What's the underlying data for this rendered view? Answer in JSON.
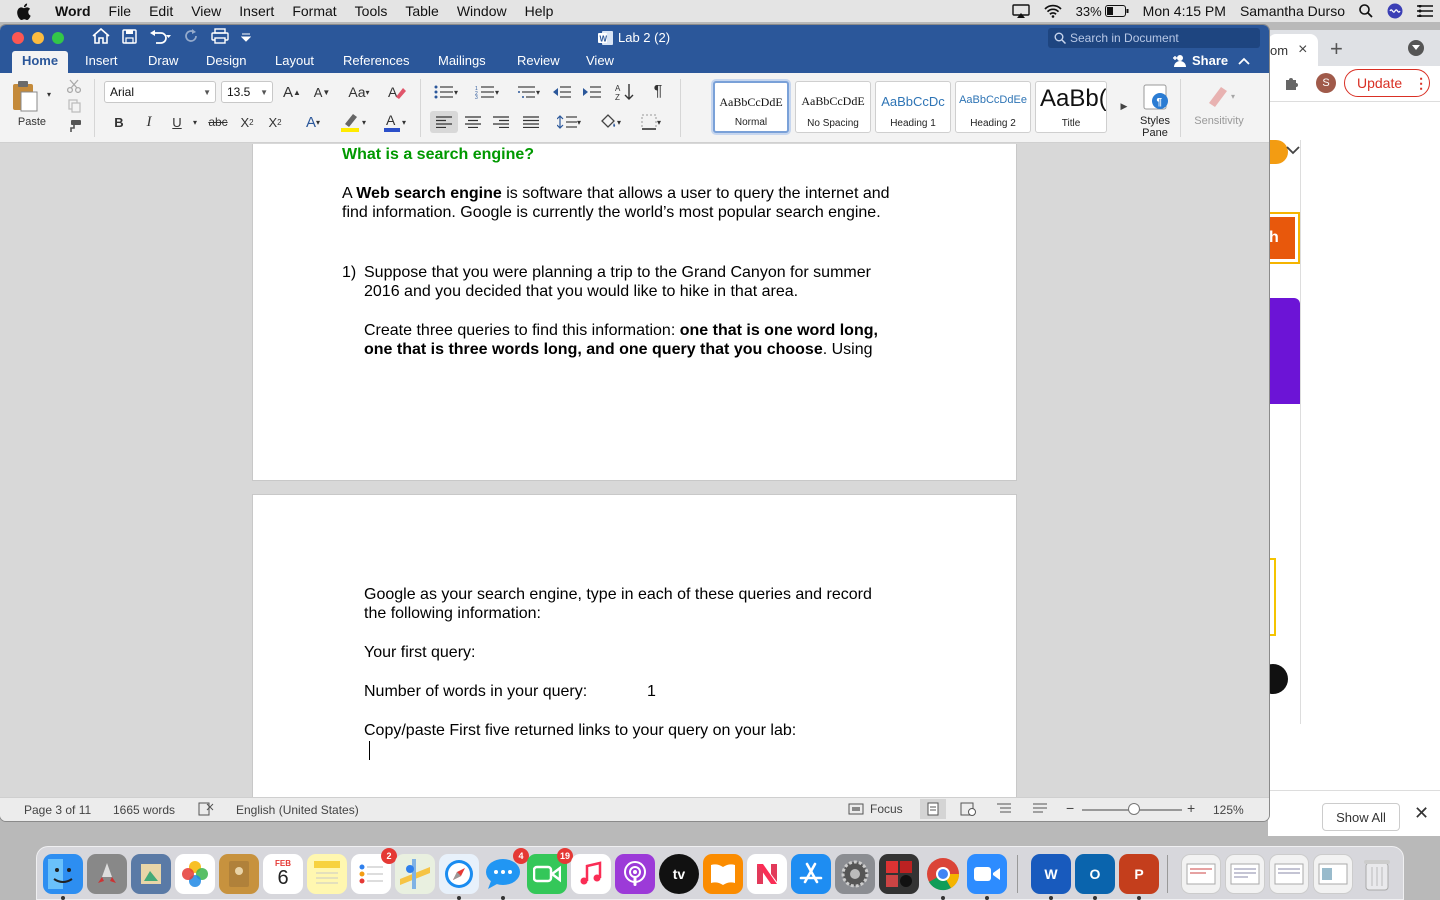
{
  "menubar": {
    "app": "Word",
    "items": [
      "File",
      "Edit",
      "View",
      "Insert",
      "Format",
      "Tools",
      "Table",
      "Window",
      "Help"
    ],
    "battery": "33%",
    "clock": "Mon 4:15 PM",
    "user": "Samantha Durso"
  },
  "word": {
    "doc_title": "Lab 2 (2)",
    "search_placeholder": "Search in Document",
    "tabs": [
      "Home",
      "Insert",
      "Draw",
      "Design",
      "Layout",
      "References",
      "Mailings",
      "Review",
      "View"
    ],
    "share": "Share",
    "font": "Arial",
    "size": "13.5",
    "paste_label": "Paste",
    "styles": [
      {
        "preview": "AaBbCcDdE",
        "name": "Normal"
      },
      {
        "preview": "AaBbCcDdE",
        "name": "No Spacing"
      },
      {
        "preview": "AaBbCcDc",
        "name": "Heading 1"
      },
      {
        "preview": "AaBbCcDdEe",
        "name": "Heading 2"
      },
      {
        "preview": "AaBb(",
        "name": "Title"
      }
    ],
    "styles_pane": [
      "Styles",
      "Pane"
    ],
    "sensitivity": "Sensitivity"
  },
  "doc": {
    "heading": "What is a search engine?",
    "para1_a": "A ",
    "para1_b": "Web search engine",
    "para1_c": " is software that allows a user to query the internet and",
    "para1_line2": "find information. Google is currently the world’s most popular search engine.",
    "q_num": "1)",
    "q_line1": "Suppose that you were planning a trip to the Grand Canyon for summer",
    "q_line2": "2016 and you decided that you would like to hike in that area.",
    "create_a": "Create three queries to find this information:  ",
    "create_b": "one that is one word long,",
    "create_line2_b": "one that is three words long, and one query that you choose",
    "create_line2_c": ". Using",
    "p2_line1": "Google as your search engine, type in each of these queries and record",
    "p2_line2": "the following information:",
    "first_query": "Your first query:",
    "num_words_label": "Number of words in your query:",
    "num_words_value": "1",
    "copy_paste": "Copy/paste First five returned links to your query on your lab:"
  },
  "status": {
    "page": "Page 3 of 11",
    "words": "1665 words",
    "language": "English (United States)",
    "focus": "Focus",
    "zoom": "125%"
  },
  "chrome": {
    "tab_text": "om",
    "update": "Update",
    "profile": "S",
    "orange_text": "h",
    "show_all": "Show All"
  },
  "dock": {
    "calendar_month": "FEB",
    "calendar_day": "6",
    "reminders_badge": "2",
    "messages_badge": "4",
    "facetime_badge": "19",
    "tv_label": "tv"
  },
  "colors": {
    "word_blue": "#2b579a",
    "heading_green": "#009900",
    "update_red": "#d93025"
  }
}
